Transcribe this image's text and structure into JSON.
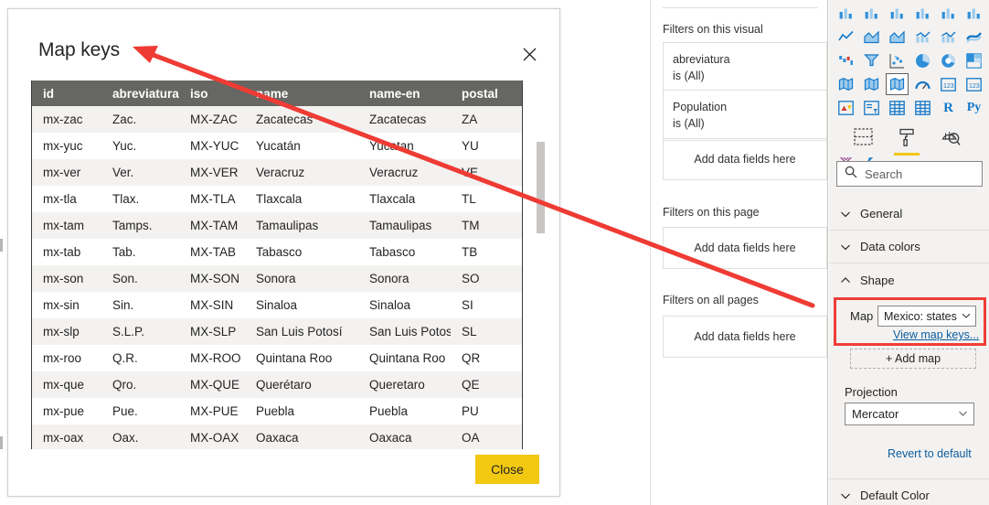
{
  "dialog": {
    "title": "Map keys",
    "close_icon": "close-icon",
    "close_button_label": "Close",
    "table": {
      "columns": [
        "id",
        "abreviatura",
        "iso",
        "name",
        "name-en",
        "postal"
      ],
      "rows": [
        [
          "mx-zac",
          "Zac.",
          "MX-ZAC",
          "Zacatecas",
          "Zacatecas",
          "ZA"
        ],
        [
          "mx-yuc",
          "Yuc.",
          "MX-YUC",
          "Yucatán",
          "Yucatan",
          "YU"
        ],
        [
          "mx-ver",
          "Ver.",
          "MX-VER",
          "Veracruz",
          "Veracruz",
          "VE"
        ],
        [
          "mx-tla",
          "Tlax.",
          "MX-TLA",
          "Tlaxcala",
          "Tlaxcala",
          "TL"
        ],
        [
          "mx-tam",
          "Tamps.",
          "MX-TAM",
          "Tamaulipas",
          "Tamaulipas",
          "TM"
        ],
        [
          "mx-tab",
          "Tab.",
          "MX-TAB",
          "Tabasco",
          "Tabasco",
          "TB"
        ],
        [
          "mx-son",
          "Son.",
          "MX-SON",
          "Sonora",
          "Sonora",
          "SO"
        ],
        [
          "mx-sin",
          "Sin.",
          "MX-SIN",
          "Sinaloa",
          "Sinaloa",
          "SI"
        ],
        [
          "mx-slp",
          "S.L.P.",
          "MX-SLP",
          "San Luis Potosí",
          "San Luis Potosi",
          "SL"
        ],
        [
          "mx-roo",
          "Q.R.",
          "MX-ROO",
          "Quintana Roo",
          "Quintana Roo",
          "QR"
        ],
        [
          "mx-que",
          "Qro.",
          "MX-QUE",
          "Querétaro",
          "Queretaro",
          "QE"
        ],
        [
          "mx-pue",
          "Pue.",
          "MX-PUE",
          "Puebla",
          "Puebla",
          "PU"
        ],
        [
          "mx-oax",
          "Oax.",
          "MX-OAX",
          "Oaxaca",
          "Oaxaca",
          "OA"
        ]
      ]
    }
  },
  "filters_pane": {
    "sections": [
      {
        "title": "Filters on this visual",
        "ellipsis": "· · ·",
        "cards": [
          {
            "name": "abreviatura",
            "condition": "is (All)"
          },
          {
            "name": "Population",
            "condition": "is (All)"
          }
        ],
        "dropzone": "Add data fields here"
      },
      {
        "title": "Filters on this page",
        "ellipsis": "· · ·",
        "cards": [],
        "dropzone": "Add data fields here"
      },
      {
        "title": "Filters on all pages",
        "ellipsis": "· · ·",
        "cards": [],
        "dropzone": "Add data fields here"
      }
    ]
  },
  "viz_pane": {
    "gallery_icons": [
      "stacked-bar-chart-icon",
      "stacked-column-chart-icon",
      "clustered-bar-chart-icon",
      "clustered-column-chart-icon",
      "100-stacked-bar-chart-icon",
      "100-stacked-column-chart-icon",
      "line-chart-icon",
      "area-chart-icon",
      "stacked-area-chart-icon",
      "line-and-stacked-column-chart-icon",
      "line-and-clustered-column-chart-icon",
      "ribbon-chart-icon",
      "waterfall-chart-icon",
      "funnel-chart-icon",
      "scatter-chart-icon",
      "pie-chart-icon",
      "donut-chart-icon",
      "treemap-icon",
      "map-icon",
      "filled-map-icon",
      "shape-map-icon",
      "gauge-icon",
      "card-icon",
      "multi-row-card-icon",
      "kpi-icon",
      "slicer-icon",
      "table-icon",
      "matrix-icon",
      "r-script-visual-icon",
      "python-visual-icon",
      "key-influencers-icon",
      "decomposition-tree-icon",
      "q-and-a-icon",
      "smart-narrative-icon",
      "paginated-report-icon",
      "arcgis-maps-icon",
      "power-apps-icon",
      "power-automate-icon",
      "more-visuals-icon"
    ],
    "selected_icon": "shape-map-icon",
    "tabs": [
      {
        "name": "fields-tab",
        "icon": "fields-icon",
        "active": false
      },
      {
        "name": "format-tab",
        "icon": "paint-roller-icon",
        "active": true
      },
      {
        "name": "analytics-tab",
        "icon": "magnifier-chart-icon",
        "active": false
      }
    ],
    "search": {
      "placeholder": "Search",
      "value": "Search",
      "icon": "search-icon"
    },
    "sections": [
      {
        "label": "General",
        "expanded": false
      },
      {
        "label": "Data colors",
        "expanded": false
      },
      {
        "label": "Shape",
        "expanded": true
      },
      {
        "label": "Default Color",
        "expanded": false
      }
    ],
    "shape": {
      "map_label": "Map",
      "map_value": "Mexico: states",
      "view_map_keys_link": "View map keys...",
      "add_map_label": "+ Add map",
      "projection_label": "Projection",
      "projection_value": "Mercator",
      "revert_label": "Revert to default"
    }
  },
  "annotation": {
    "arrow_color": "#ee3b34",
    "highlight_color": "#ef3e36",
    "accent_yellow": "#f2c811"
  }
}
